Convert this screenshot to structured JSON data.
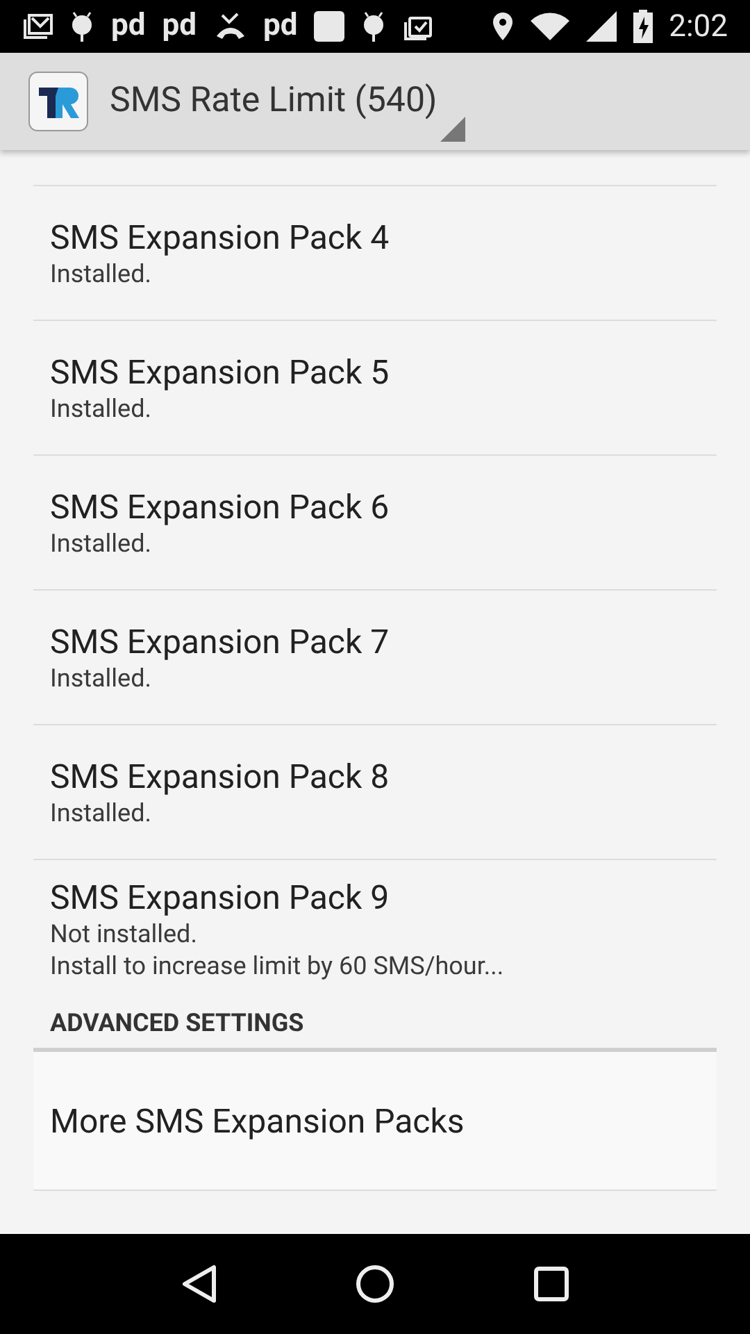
{
  "status_bar": {
    "notifications": [
      {
        "kind": "mail"
      },
      {
        "kind": "android"
      },
      {
        "kind": "text",
        "label": "pd"
      },
      {
        "kind": "text",
        "label": "pd"
      },
      {
        "kind": "missed-call"
      },
      {
        "kind": "text",
        "label": "pd"
      },
      {
        "kind": "square"
      },
      {
        "kind": "android"
      },
      {
        "kind": "clipboard"
      }
    ],
    "time": "2:02"
  },
  "app_bar": {
    "title": "SMS Rate Limit (540)"
  },
  "packs": [
    {
      "title": "SMS Expansion Pack 4",
      "lines": [
        "Installed."
      ]
    },
    {
      "title": "SMS Expansion Pack 5",
      "lines": [
        "Installed."
      ]
    },
    {
      "title": "SMS Expansion Pack 6",
      "lines": [
        "Installed."
      ]
    },
    {
      "title": "SMS Expansion Pack 7",
      "lines": [
        "Installed."
      ]
    },
    {
      "title": "SMS Expansion Pack 8",
      "lines": [
        "Installed."
      ]
    },
    {
      "title": "SMS Expansion Pack 9",
      "lines": [
        "Not installed.",
        "Install to increase limit by 60 SMS/hour..."
      ]
    }
  ],
  "section": {
    "header": "ADVANCED SETTINGS",
    "items": [
      {
        "title": "More SMS Expansion Packs"
      }
    ]
  }
}
